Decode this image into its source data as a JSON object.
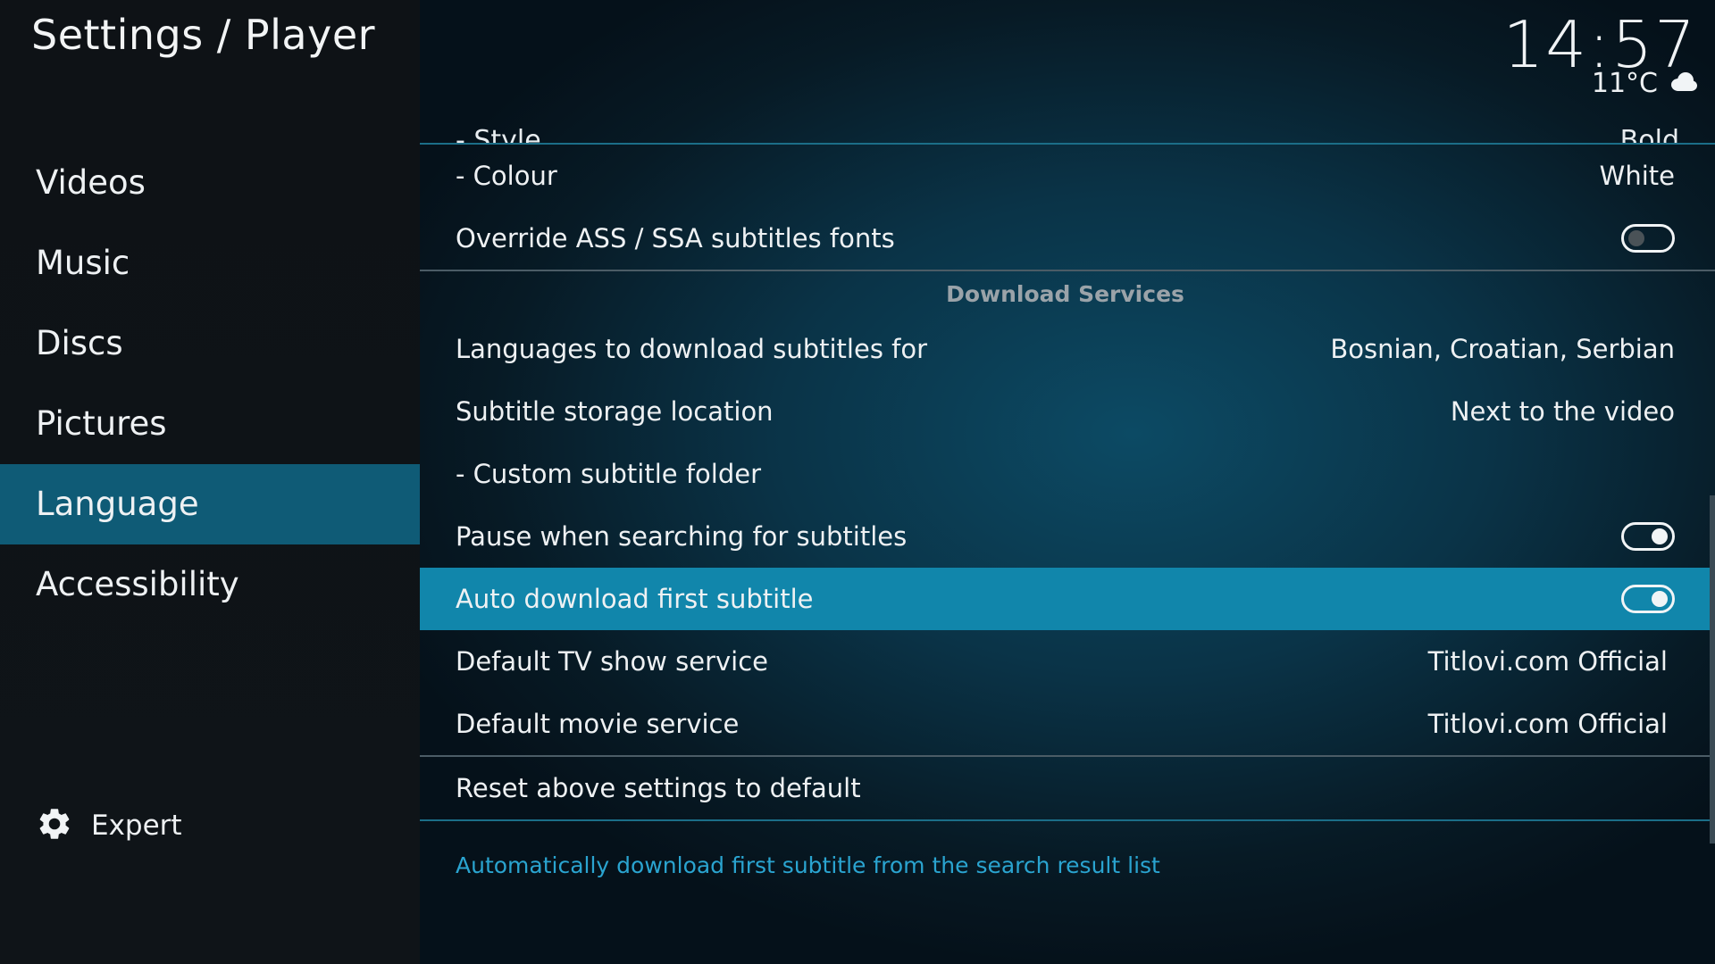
{
  "header": {
    "title": "Settings / Player",
    "clock": "14:57",
    "temperature": "11°C",
    "weather_icon": "cloud-icon"
  },
  "sidebar": {
    "items": [
      {
        "label": "Videos"
      },
      {
        "label": "Music"
      },
      {
        "label": "Discs"
      },
      {
        "label": "Pictures"
      },
      {
        "label": "Language"
      },
      {
        "label": "Accessibility"
      }
    ],
    "active_index": 4,
    "expert_label": "Expert"
  },
  "settings": {
    "cut_off_label": "- Style",
    "cut_off_value": "Bold",
    "top_rows": [
      {
        "label": "- Colour",
        "value": "White"
      },
      {
        "label": "Override ASS / SSA subtitles fonts",
        "toggle": "off"
      }
    ],
    "section_title": "Download Services",
    "rows": [
      {
        "label": "Languages to download subtitles for",
        "value": "Bosnian, Croatian, Serbian"
      },
      {
        "label": "Subtitle storage location",
        "value": "Next to the video"
      },
      {
        "label": "- Custom subtitle folder",
        "value": ""
      },
      {
        "label": "Pause when searching for subtitles",
        "toggle": "on"
      },
      {
        "label": "Auto download first subtitle",
        "toggle": "on"
      },
      {
        "label": "Default TV show service",
        "value": "Titlovi.com Official"
      },
      {
        "label": "Default movie service",
        "value": "Titlovi.com Official"
      }
    ],
    "focused_row": "Auto download first subtitle",
    "reset_label": "Reset above settings to default"
  },
  "description": "Automatically download first subtitle from the search result list",
  "colors": {
    "focus": "#1186ab",
    "sidebar_active": "#0f5b76",
    "description": "#2aa4d0"
  }
}
